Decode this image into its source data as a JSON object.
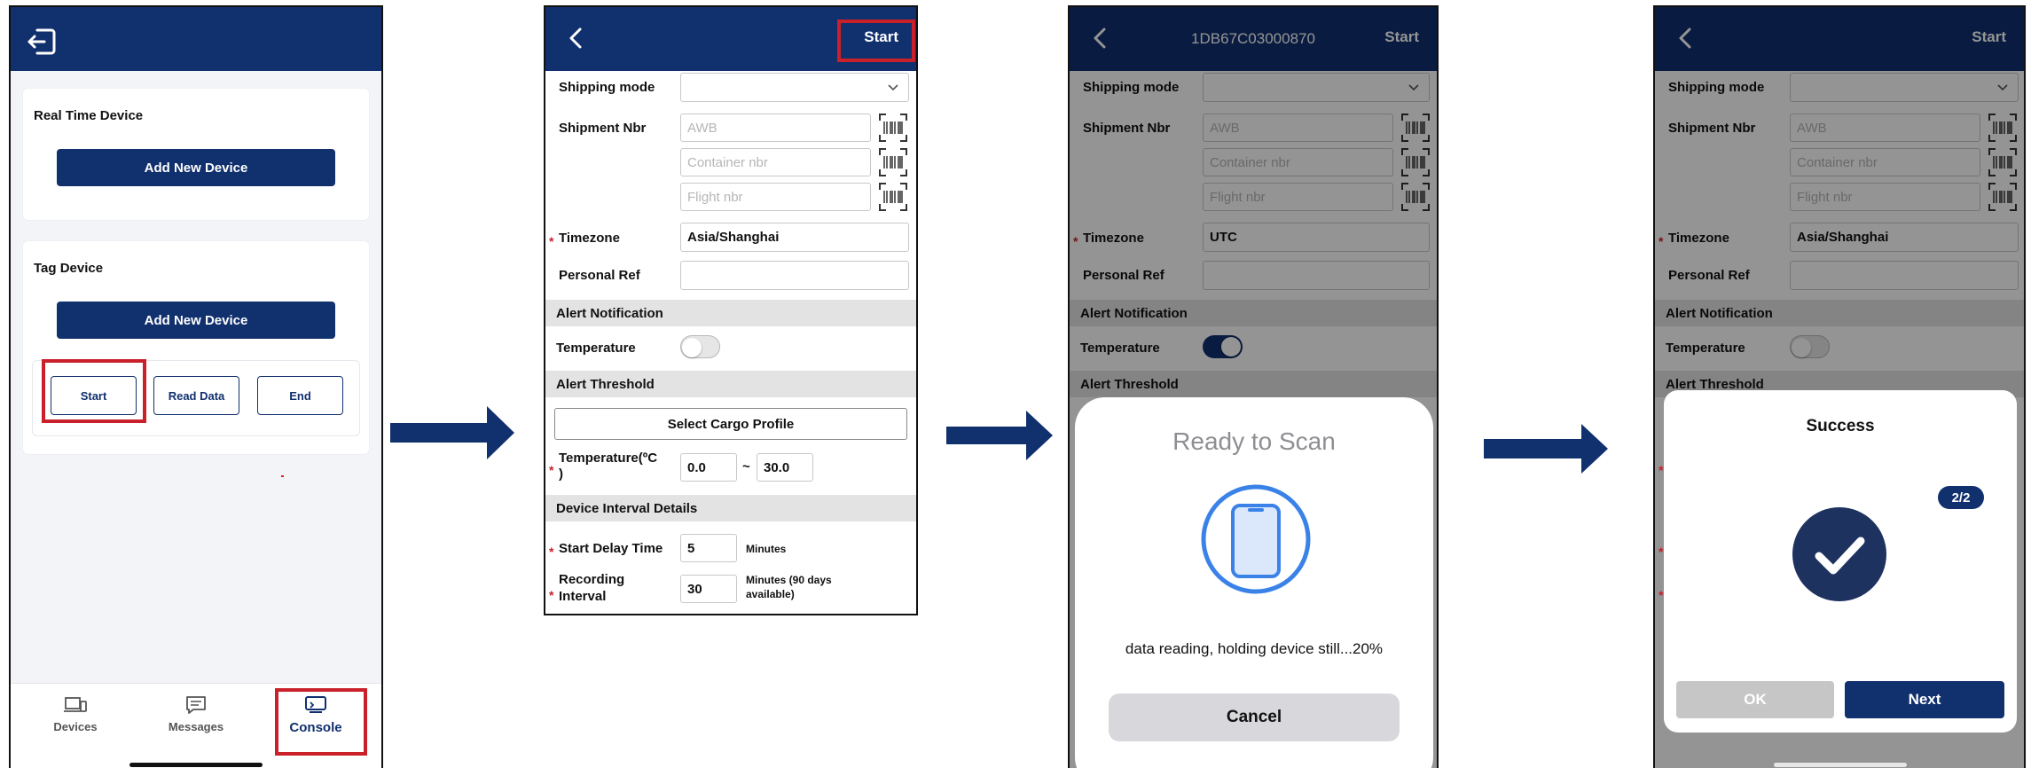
{
  "colors": {
    "navy": "#11306e",
    "highlight_red": "#c9202a",
    "section_gray": "#e3e3e3",
    "scan_blue": "#3b82e8",
    "required_red": "#c9202a"
  },
  "screen1": {
    "real_time_title": "Real Time Device",
    "real_time_add": "Add New Device",
    "tag_title": "Tag Device",
    "tag_add": "Add New Device",
    "start": "Start",
    "read_data": "Read Data",
    "end": "End",
    "tabs": {
      "devices": "Devices",
      "messages": "Messages",
      "console": "Console"
    }
  },
  "screen2": {
    "start_label": "Start",
    "shipping_mode_label": "Shipping mode",
    "shipment_nbr_label": "Shipment Nbr",
    "awb_placeholder": "AWB",
    "container_placeholder": "Container nbr",
    "flight_placeholder": "Flight nbr",
    "required_mark": "*",
    "timezone_label": "Timezone",
    "timezone_value": "Asia/Shanghai",
    "personal_ref_label": "Personal Ref",
    "alert_notification": "Alert Notification",
    "temperature_label": "Temperature",
    "alert_threshold": "Alert Threshold",
    "select_cargo_profile": "Select Cargo Profile",
    "temperature_range_label": "Temperature(ºC\n)",
    "temp_min": "0.0",
    "range_sep": "~",
    "temp_max": "30.0",
    "device_interval": "Device Interval Details",
    "start_delay_label": "Start Delay Time",
    "start_delay_value": "5",
    "minutes": "Minutes",
    "recording_label": "Recording Interval",
    "recording_value": "30",
    "recording_note": "Minutes (90 days available)"
  },
  "screen3": {
    "title": "1DB67C03000870",
    "start_label": "Start",
    "timezone_value": "UTC",
    "scan_title": "Ready to Scan",
    "scan_status": "data reading, holding device still...20%",
    "cancel": "Cancel"
  },
  "screen4": {
    "start_label": "Start",
    "timezone_value": "Asia/Shanghai",
    "success_title": "Success",
    "counter": "2/2",
    "ok": "OK",
    "next": "Next"
  }
}
